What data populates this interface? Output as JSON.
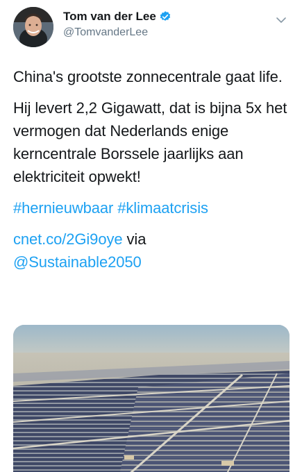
{
  "author": {
    "display_name": "Tom van der Lee",
    "handle": "@TomvanderLee",
    "verified": true,
    "avatar_icon": "person-portrait-avatar"
  },
  "menu_icon": "chevron-down-icon",
  "tweet": {
    "paragraph1": "China's grootste zonnecentrale gaat life.",
    "paragraph2": "Hij levert 2,2 Gigawatt, dat is bijna 5x het vermogen dat Nederlands enige kerncentrale Borssele jaarlijks aan elektriciteit opwekt!",
    "hashtags": [
      "#hernieuwbaar",
      "#klimaatcrisis"
    ],
    "link_text": "cnet.co/2Gi9oye",
    "via_text": "via",
    "mention": "@Sustainable2050"
  },
  "media": {
    "kind": "photo",
    "subject": "aerial-solar-farm"
  },
  "colors": {
    "accent": "#1da1f2",
    "text": "#14171a",
    "secondary": "#657786"
  }
}
